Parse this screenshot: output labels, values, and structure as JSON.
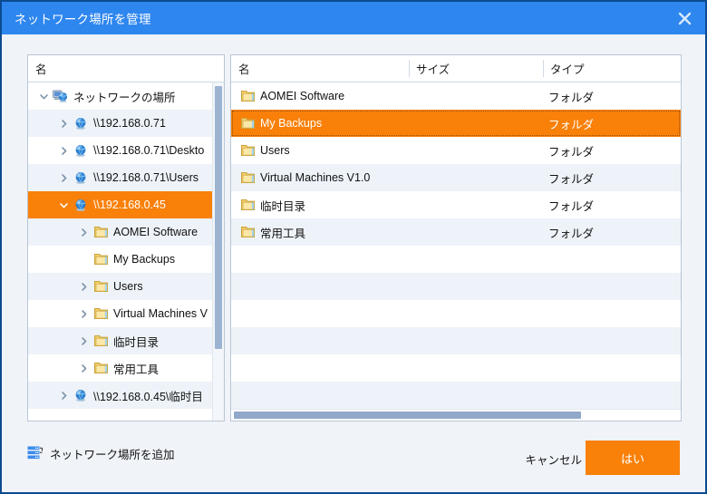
{
  "window": {
    "title": "ネットワーク場所を管理",
    "close_icon": "close-icon",
    "titlebar_color": "#2e86ef",
    "accent_color": "#f98009",
    "border_color": "#0b4a8f"
  },
  "left_panel": {
    "column_header": "名",
    "items": [
      {
        "label": "ネットワークの場所",
        "indent": 0,
        "expander": "down",
        "icon": "network-computer-icon",
        "selected": false
      },
      {
        "label": "\\\\192.168.0.71",
        "indent": 1,
        "expander": "right",
        "icon": "network-globe-icon",
        "selected": false
      },
      {
        "label": "\\\\192.168.0.71\\Deskto",
        "indent": 1,
        "expander": "right",
        "icon": "network-globe-icon",
        "selected": false
      },
      {
        "label": "\\\\192.168.0.71\\Users",
        "indent": 1,
        "expander": "right",
        "icon": "network-globe-icon",
        "selected": false
      },
      {
        "label": "\\\\192.168.0.45",
        "indent": 1,
        "expander": "down",
        "icon": "network-globe-icon",
        "selected": true
      },
      {
        "label": "AOMEI Software",
        "indent": 2,
        "expander": "right",
        "icon": "folder-icon",
        "selected": false
      },
      {
        "label": "My Backups",
        "indent": 2,
        "expander": "none",
        "icon": "folder-icon",
        "selected": false
      },
      {
        "label": "Users",
        "indent": 2,
        "expander": "right",
        "icon": "folder-icon",
        "selected": false
      },
      {
        "label": "Virtual Machines V",
        "indent": 2,
        "expander": "right",
        "icon": "folder-icon",
        "selected": false
      },
      {
        "label": "临时目录",
        "indent": 2,
        "expander": "right",
        "icon": "folder-icon",
        "selected": false
      },
      {
        "label": "常用工具",
        "indent": 2,
        "expander": "right",
        "icon": "folder-icon",
        "selected": false
      },
      {
        "label": "\\\\192.168.0.45\\临时目",
        "indent": 1,
        "expander": "right",
        "icon": "network-globe-icon",
        "selected": false
      }
    ]
  },
  "right_panel": {
    "columns": [
      "名",
      "サイズ",
      "タイプ"
    ],
    "rows": [
      {
        "name": "AOMEI Software",
        "size": "",
        "type": "フォルダ",
        "icon": "folder-icon",
        "selected": false
      },
      {
        "name": "My Backups",
        "size": "",
        "type": "フォルダ",
        "icon": "folder-icon",
        "selected": true
      },
      {
        "name": "Users",
        "size": "",
        "type": "フォルダ",
        "icon": "folder-icon",
        "selected": false
      },
      {
        "name": "Virtual Machines V1.0",
        "size": "",
        "type": "フォルダ",
        "icon": "folder-icon",
        "selected": false
      },
      {
        "name": "临时目录",
        "size": "",
        "type": "フォルダ",
        "icon": "folder-icon",
        "selected": false
      },
      {
        "name": "常用工具",
        "size": "",
        "type": "フォルダ",
        "icon": "folder-icon",
        "selected": false
      }
    ]
  },
  "footer": {
    "add_label": "ネットワーク場所を追加",
    "add_icon": "server-stack-icon",
    "cancel_label": "キャンセル",
    "confirm_label": "はい"
  }
}
